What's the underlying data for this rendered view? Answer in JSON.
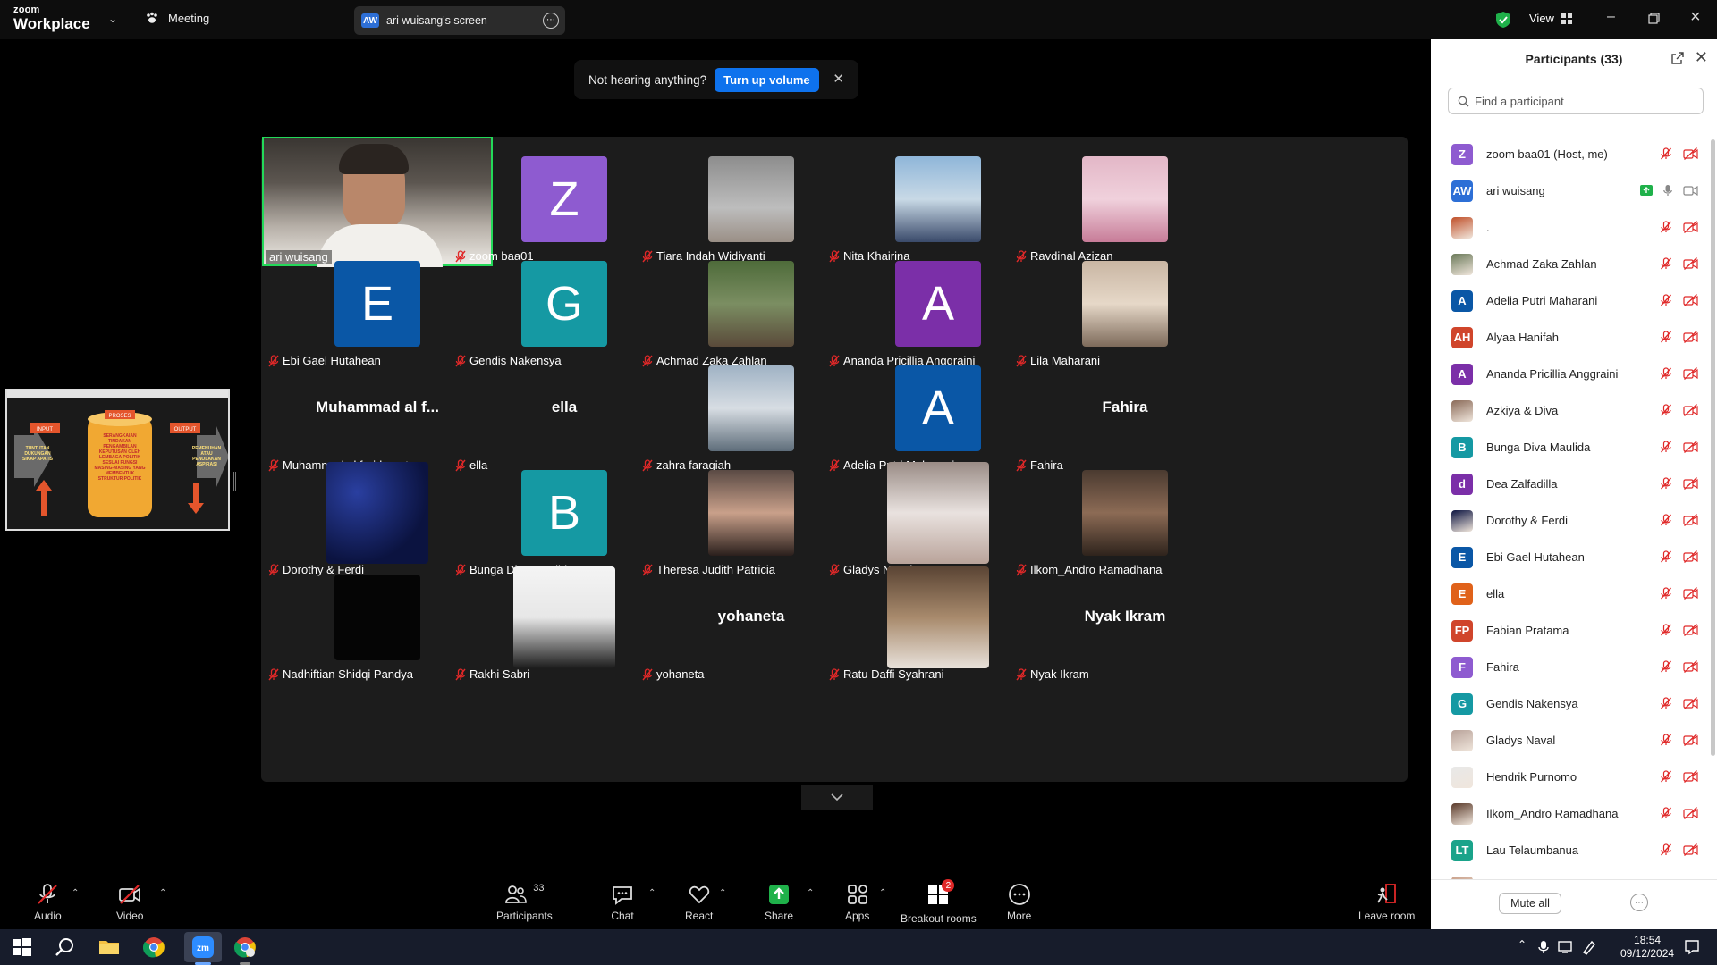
{
  "titlebar": {
    "brand_top": "zoom",
    "brand_bottom": "Workplace",
    "meeting_label": "Meeting",
    "screen_initials": "AW",
    "screen_label": "ari wuisang's screen",
    "view_label": "View"
  },
  "banner": {
    "text": "Not hearing anything?",
    "button": "Turn up volume"
  },
  "gallery": [
    {
      "name": "ari wuisang",
      "type": "video",
      "muted": false
    },
    {
      "name": "zoom baa01",
      "type": "avatar",
      "initial": "Z",
      "color": "#8e5bd0"
    },
    {
      "name": "Tiara Indah Widiyanti",
      "type": "photo",
      "photo": "ph-gray"
    },
    {
      "name": "Nita Khairina",
      "type": "photo",
      "photo": "ph-sky"
    },
    {
      "name": "Ravdinal Azizan",
      "type": "photo",
      "photo": "ph-pink"
    },
    {
      "name": "Ebi Gael Hutahean",
      "type": "avatar",
      "initial": "E",
      "color": "#0a57a6"
    },
    {
      "name": "Gendis Nakensya",
      "type": "avatar",
      "initial": "G",
      "color": "#1599a3"
    },
    {
      "name": "Achmad Zaka Zahlan",
      "type": "photo",
      "photo": "ph-trees"
    },
    {
      "name": "Ananda Pricillia Anggraini",
      "type": "avatar",
      "initial": "A",
      "color": "#7b2fa8"
    },
    {
      "name": "Lila Maharani",
      "type": "photo",
      "photo": "ph-warm"
    },
    {
      "name": "Muhammad al farid marta",
      "type": "name",
      "display": "Muhammad al f..."
    },
    {
      "name": "ella",
      "type": "name",
      "display": "ella"
    },
    {
      "name": "zahra faraqiah",
      "type": "photo",
      "photo": "ph-building"
    },
    {
      "name": "Adelia Putri Maharani",
      "type": "avatar",
      "initial": "A",
      "color": "#0a57a6"
    },
    {
      "name": "Fahira",
      "type": "name",
      "display": "Fahira"
    },
    {
      "name": "Dorothy & Ferdi",
      "type": "photo",
      "photo": "ph-night",
      "big": true
    },
    {
      "name": "Bunga Diva Maulida",
      "type": "avatar",
      "initial": "B",
      "color": "#1599a3"
    },
    {
      "name": "Theresa Judith Patricia",
      "type": "photo",
      "photo": "ph-portrait"
    },
    {
      "name": "Gladys Naval",
      "type": "photo",
      "photo": "ph-cat",
      "big": true
    },
    {
      "name": "Ilkom_Andro Ramadhana",
      "type": "photo",
      "photo": "ph-face"
    },
    {
      "name": "Nadhiftian Shidqi Pandya",
      "type": "photo",
      "photo": "ph-black"
    },
    {
      "name": "Rakhi Sabri",
      "type": "photo",
      "photo": "ph-white",
      "big": true
    },
    {
      "name": "yohaneta",
      "type": "name",
      "display": "yohaneta"
    },
    {
      "name": "Ratu Daffi Syahrani",
      "type": "photo",
      "photo": "ph-cafe",
      "big": true
    },
    {
      "name": "Nyak Ikram",
      "type": "name",
      "display": "Nyak Ikram"
    }
  ],
  "share_thumb": {
    "input": "INPUT",
    "proses": "PROSES",
    "output": "OUTPUT",
    "left_text": "TUNTUTAN DUKUNGAN SIKAP APATIS",
    "mid_text": "SERANGKAIAN TINDAKAN PENGAMBILAN KEPUTUSAN OLEH LEMBAGA POLITIK SESUAI FUNGSI MASING-MASING YANG MEMBENTUK STRUKTUR POLITIK",
    "right_text": "PEMENUHAN ATAU PENOLAKAN ASPIRASI"
  },
  "panel": {
    "title": "Participants (33)",
    "search_placeholder": "Find a participant",
    "mute_all": "Mute all",
    "participants": [
      {
        "name": "zoom baa01 (Host, me)",
        "initials": "Z",
        "color": "#8e5bd0"
      },
      {
        "name": "ari wuisang",
        "initials": "AW",
        "color": "#2d6fd6",
        "sharing": true
      },
      {
        "name": ".",
        "initials": "",
        "color": "#c0502a",
        "photo": true
      },
      {
        "name": "Achmad Zaka Zahlan",
        "initials": "",
        "color": "#6b7a5a",
        "photo": true
      },
      {
        "name": "Adelia Putri Maharani",
        "initials": "A",
        "color": "#0a57a6"
      },
      {
        "name": "Alyaa Hanifah",
        "initials": "AH",
        "color": "#d0452b"
      },
      {
        "name": "Ananda Pricillia Anggraini",
        "initials": "A",
        "color": "#7b2fa8"
      },
      {
        "name": "Azkiya & Diva",
        "initials": "",
        "color": "#8a6a58",
        "photo": true
      },
      {
        "name": "Bunga Diva Maulida",
        "initials": "B",
        "color": "#1599a3"
      },
      {
        "name": "Dea Zalfadilla",
        "initials": "d",
        "color": "#7b2fa8"
      },
      {
        "name": "Dorothy & Ferdi",
        "initials": "",
        "color": "#0b1340",
        "photo": true
      },
      {
        "name": "Ebi Gael Hutahean",
        "initials": "E",
        "color": "#0a57a6"
      },
      {
        "name": "ella",
        "initials": "E",
        "color": "#e0621a"
      },
      {
        "name": "Fabian Pratama",
        "initials": "FP",
        "color": "#d0452b"
      },
      {
        "name": "Fahira",
        "initials": "F",
        "color": "#8e5bd0"
      },
      {
        "name": "Gendis Nakensya",
        "initials": "G",
        "color": "#1599a3"
      },
      {
        "name": "Gladys Naval",
        "initials": "",
        "color": "#b9a39a",
        "photo": true
      },
      {
        "name": "Hendrik Purnomo",
        "initials": "",
        "color": "#e8e8e8",
        "photo": true
      },
      {
        "name": "Ilkom_Andro Ramadhana",
        "initials": "",
        "color": "#5a3a2a",
        "photo": true
      },
      {
        "name": "Lau Telaumbanua",
        "initials": "LT",
        "color": "#1aa38a"
      },
      {
        "name": "Lila Maharani",
        "initials": "",
        "color": "#c9a08a",
        "photo": true
      }
    ]
  },
  "toolbar": {
    "audio": "Audio",
    "video": "Video",
    "participants": "Participants",
    "participants_count": "33",
    "chat": "Chat",
    "react": "React",
    "share": "Share",
    "apps": "Apps",
    "breakout": "Breakout rooms",
    "breakout_badge": "2",
    "more": "More",
    "leave": "Leave room"
  },
  "clock": {
    "time": "18:54",
    "date": "09/12/2024"
  },
  "colors": {
    "accent_blue": "#0e72ed",
    "active_green": "#23d959",
    "muted_red": "#e02828"
  }
}
